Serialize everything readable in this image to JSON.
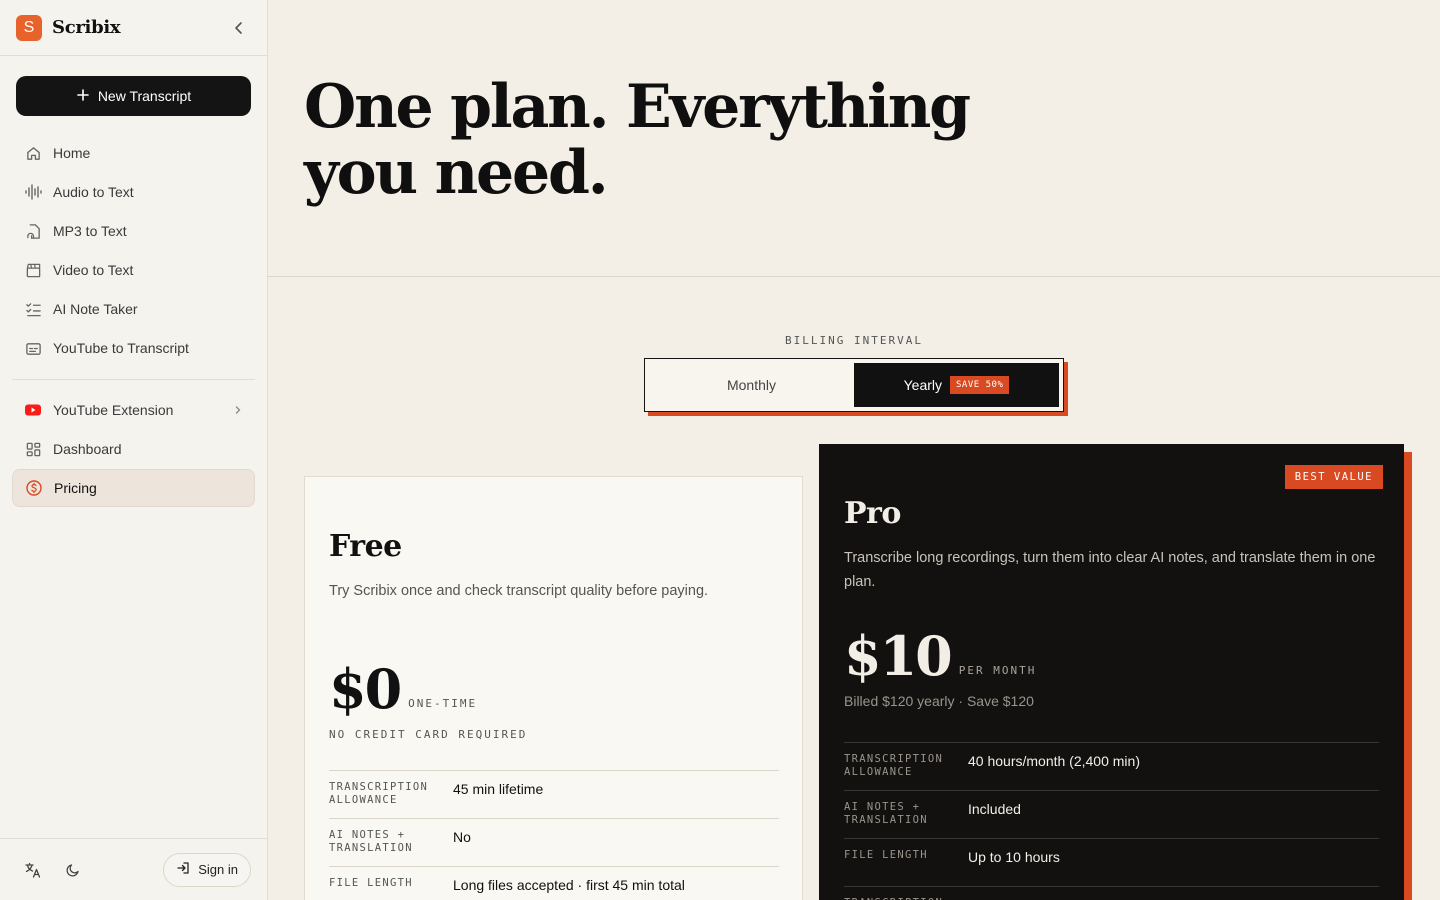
{
  "app": {
    "brand_initial": "S",
    "brand_name": "Scribix"
  },
  "sidebar": {
    "new_button_label": "New Transcript",
    "items": [
      {
        "label": "Home",
        "icon": "home-icon"
      },
      {
        "label": "Audio to Text",
        "icon": "waveform-icon"
      },
      {
        "label": "MP3 to Text",
        "icon": "audio-file-icon"
      },
      {
        "label": "Video to Text",
        "icon": "clapperboard-icon"
      },
      {
        "label": "AI Note Taker",
        "icon": "checklist-icon"
      },
      {
        "label": "YouTube to Transcript",
        "icon": "captions-icon"
      }
    ],
    "secondary_items": [
      {
        "label": "YouTube Extension",
        "icon": "youtube-icon"
      },
      {
        "label": "Dashboard",
        "icon": "dashboard-icon"
      },
      {
        "label": "Pricing",
        "icon": "dollar-circle-icon",
        "active": true
      }
    ],
    "sign_in_label": "Sign in"
  },
  "hero": {
    "title": "One plan. Everything you need."
  },
  "billing": {
    "label": "BILLING INTERVAL",
    "monthly_label": "Monthly",
    "yearly_label": "Yearly",
    "save_badge": "SAVE 50%",
    "selected": "Yearly"
  },
  "plans": {
    "free": {
      "name": "Free",
      "description": "Try Scribix once and check transcript quality before paying.",
      "price": "$0",
      "price_period": "ONE-TIME",
      "note": "NO CREDIT CARD REQUIRED",
      "features": [
        {
          "key": "TRANSCRIPTION ALLOWANCE",
          "value": "45 min lifetime"
        },
        {
          "key": "AI NOTES + TRANSLATION",
          "value": "No"
        },
        {
          "key": "FILE LENGTH",
          "value": "Long files accepted · first 45 min total"
        }
      ]
    },
    "pro": {
      "badge": "BEST VALUE",
      "name": "Pro",
      "description": "Transcribe long recordings, turn them into clear AI notes, and translate them in one plan.",
      "price": "$10",
      "price_period": "PER MONTH",
      "note": "Billed $120 yearly · Save $120",
      "features": [
        {
          "key": "TRANSCRIPTION ALLOWANCE",
          "value": "40 hours/month (2,400 min)"
        },
        {
          "key": "AI NOTES + TRANSLATION",
          "value": "Included"
        },
        {
          "key": "FILE LENGTH",
          "value": "Up to 10 hours"
        },
        {
          "key": "TRANSCRIPTION",
          "value": ""
        }
      ]
    }
  },
  "colors": {
    "accent": "#d94a22",
    "brand": "#e8622c",
    "dark": "#12110f",
    "background": "#f3efe6"
  }
}
